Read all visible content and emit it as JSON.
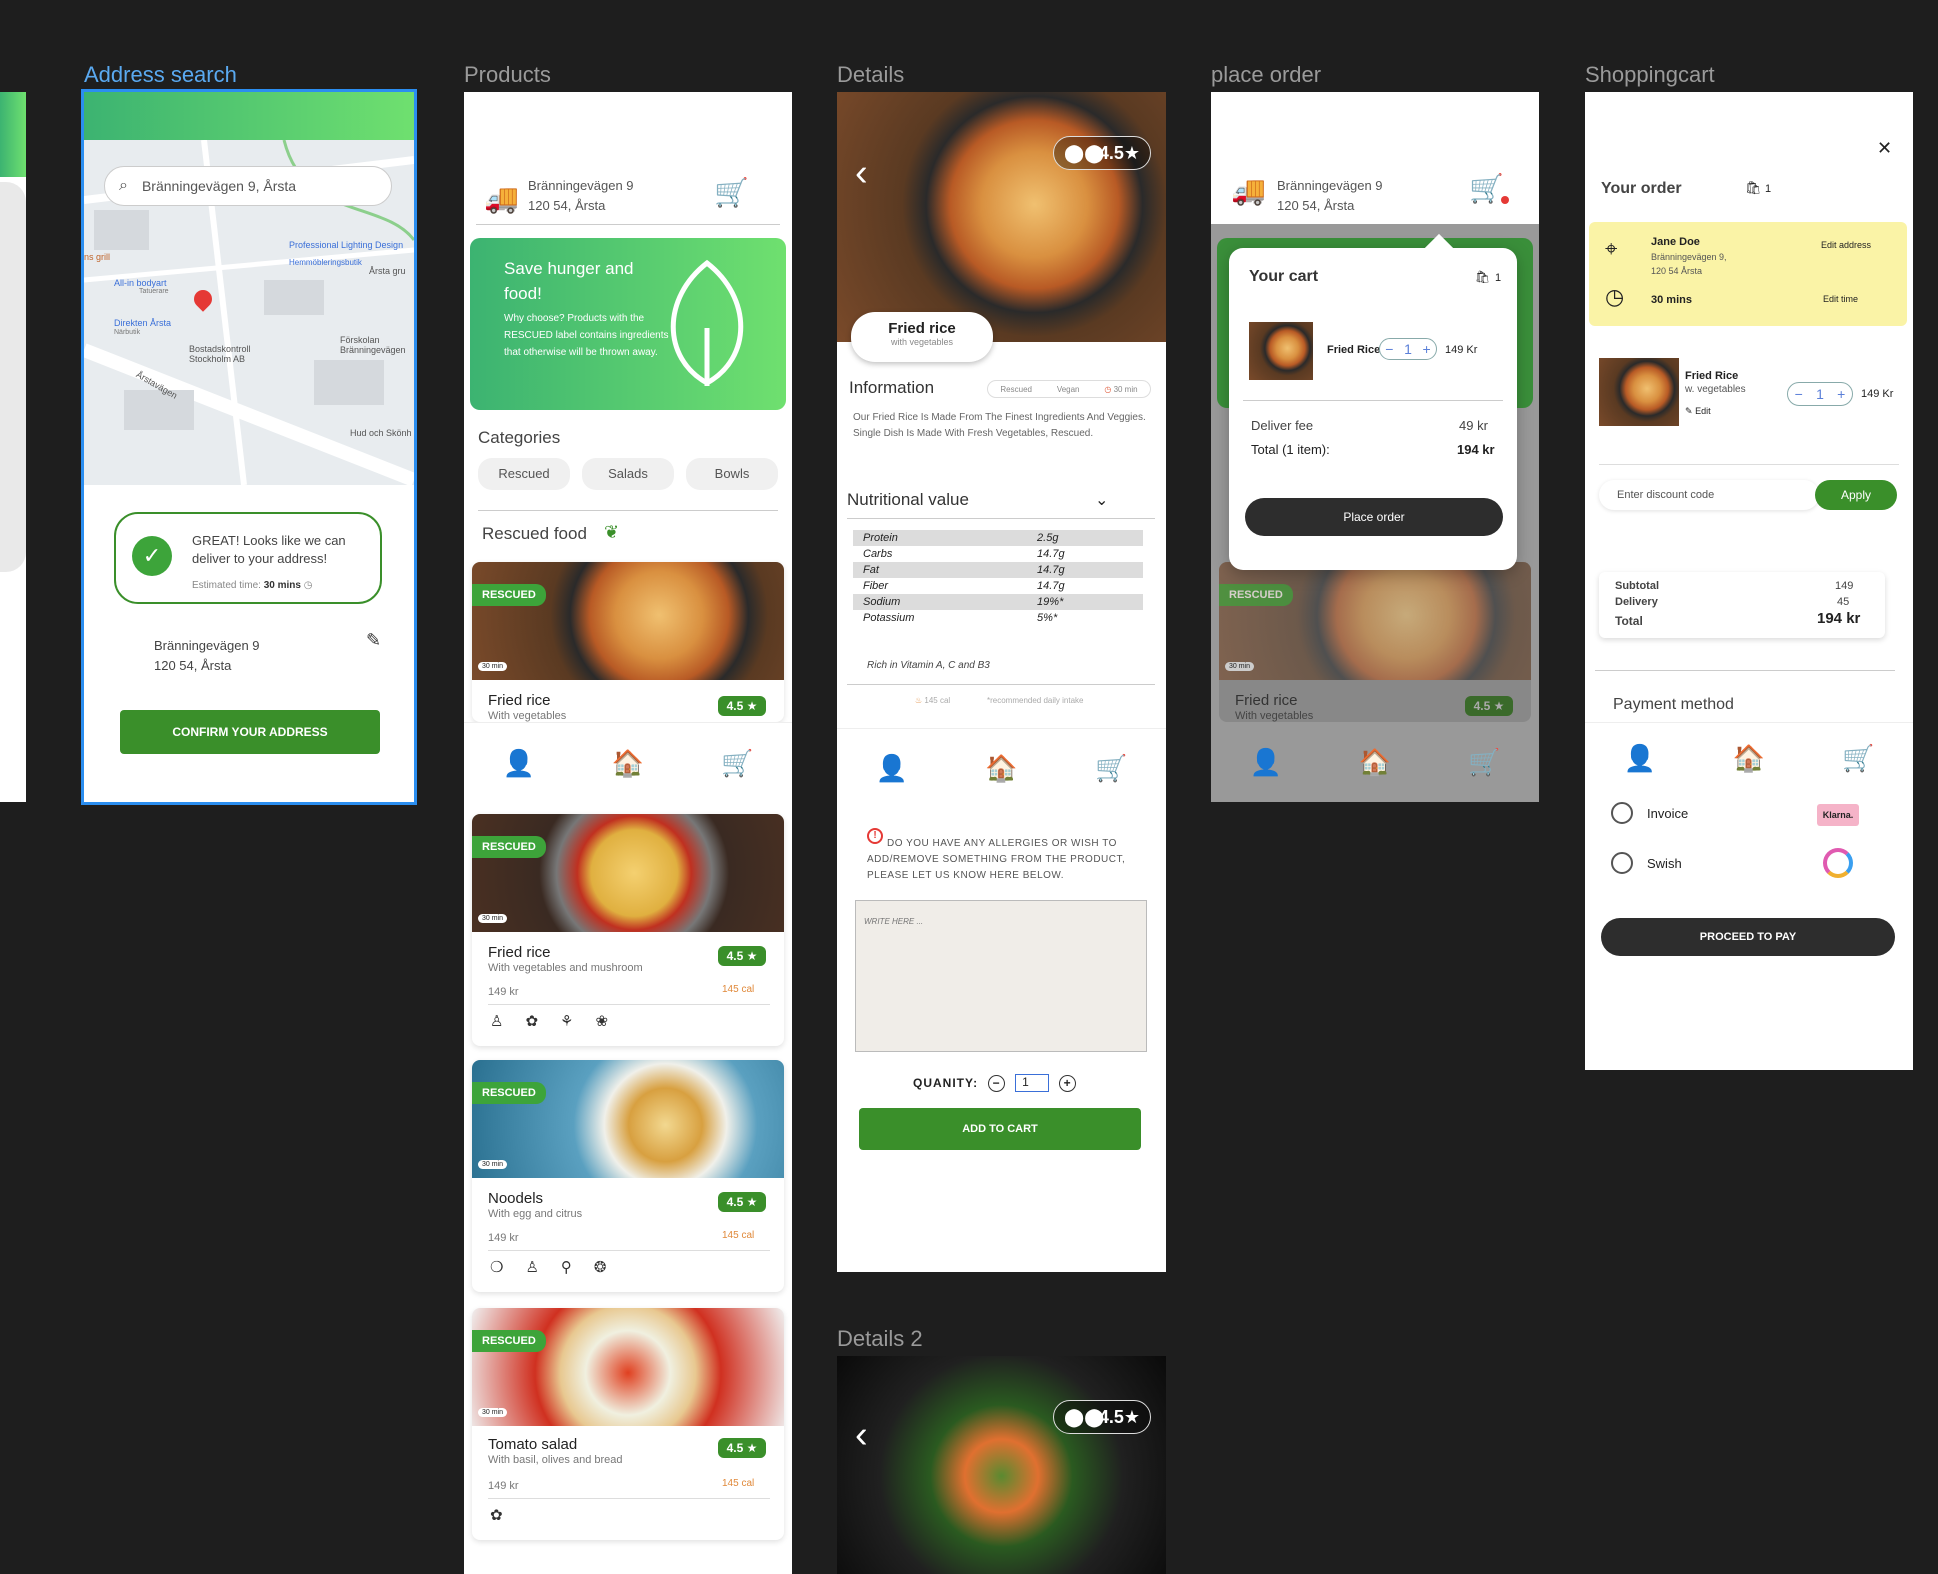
{
  "frames": {
    "address_search": "Address search",
    "products": "Products",
    "details": "Details",
    "place_order": "place order",
    "shoppingcart": "Shoppingcart",
    "details2": "Details 2"
  },
  "address": {
    "search_value": "Bränningevägen 9, Årsta",
    "map_labels": [
      "Professional Lighting Design",
      "Hemmöbleringsbutik",
      "Årsta gru",
      "ns grill",
      "All-in bodyart",
      "Tatuerare",
      "Direkten Årsta",
      "Närbutik",
      "Förskolan Bränningevägen",
      "Bostadskontroll Stockholm AB",
      "Årstavägen",
      "Hud och Skönh"
    ],
    "great_msg": "GREAT! Looks like we can deliver to your address!",
    "estimated_label": "Estimated time:",
    "estimated_value": "30 mins",
    "street": "Bränningevägen 9",
    "postal": "120 54, Årsta",
    "confirm_btn": "CONFIRM YOUR ADDRESS"
  },
  "products": {
    "street": "Bränningevägen 9",
    "postal": "120 54, Årsta",
    "banner_title": "Save hunger and food!",
    "banner_body": "Why choose? Products with the RESCUED label contains ingredients that otherwise will be thrown away.",
    "categories_title": "Categories",
    "categories": [
      "Rescued",
      "Salads",
      "Bowls"
    ],
    "rescued_title": "Rescued food",
    "rescued_tag": "RESCUED",
    "time_tag": "30 min",
    "items": [
      {
        "name": "Fried rice",
        "sub": "With vegetables",
        "rating": "4.5 ★",
        "price": "",
        "cal": ""
      },
      {
        "name": "Fried rice",
        "sub": "With vegetables and mushroom",
        "rating": "4.5 ★",
        "price": "149 kr",
        "cal": "145 cal"
      },
      {
        "name": "Noodels",
        "sub": "With egg and citrus",
        "rating": "4.5 ★",
        "price": "149 kr",
        "cal": "145 cal"
      },
      {
        "name": "Tomato salad",
        "sub": "With basil, olives and bread",
        "rating": "4.5 ★",
        "price": "149 kr",
        "cal": "145 cal"
      }
    ]
  },
  "details": {
    "rating": "4.5★",
    "name": "Fried rice",
    "sub": "with vegetables",
    "info_title": "Information",
    "tags": [
      "Rescued",
      "Vegan",
      "30 min"
    ],
    "description": "Our Fried Rice Is Made From The Finest Ingredients And Veggies. Single Dish Is Made With Fresh Vegetables, Rescued.",
    "nutrition_title": "Nutritional value",
    "nutrition": [
      {
        "k": "Protein",
        "v": "2.5g"
      },
      {
        "k": "Carbs",
        "v": "14.7g"
      },
      {
        "k": "Fat",
        "v": "14.7g"
      },
      {
        "k": "Fiber",
        "v": "14.7g"
      },
      {
        "k": "Sodium",
        "v": "19%*"
      },
      {
        "k": "Potassium",
        "v": "5%*"
      }
    ],
    "vitamins": "Rich in Vitamin A, C and B3",
    "cal": "145 cal",
    "footnote": "*recommended daily intake",
    "allergy": "DO YOU HAVE ANY ALLERGIES OR WISH TO ADD/REMOVE SOMETHING FROM THE PRODUCT, PLEASE LET US KNOW HERE BELOW.",
    "placeholder": "WRITE HERE ...",
    "qty_label": "QUANITY:",
    "qty_value": "1",
    "add_btn": "ADD TO CART"
  },
  "place_order": {
    "street": "Bränningevägen 9",
    "postal": "120 54, Årsta",
    "cart_title": "Your cart",
    "cart_count": "1",
    "item_name": "Fried Rice",
    "item_qty": "1",
    "item_price": "149 Kr",
    "fee_label": "Deliver fee",
    "fee_value": "49 kr",
    "total_label": "Total (1 item):",
    "total_value": "194 kr",
    "place_btn": "Place order",
    "rescued_tag": "RESCUED",
    "time_tag": "30 min",
    "bg_item_name": "Fried rice",
    "bg_item_sub": "With vegetables",
    "bg_rating": "4.5 ★"
  },
  "cart": {
    "title": "Your order",
    "count": "1",
    "name": "Jane Doe",
    "addr1": "Bränningevägen 9,",
    "addr2": "120 54 Årsta",
    "edit_address": "Edit address",
    "time": "30 mins",
    "edit_time": "Edit time",
    "item_name": "Fried Rice",
    "item_sub": "w. vegetables",
    "item_edit": "Edit",
    "item_qty": "1",
    "item_price": "149 Kr",
    "discount_placeholder": "Enter discount code",
    "apply": "Apply",
    "subtotal_label": "Subtotal",
    "delivery_label": "Delivery",
    "total_label": "Total",
    "subtotal_value": "149",
    "delivery_value": "45",
    "total_value": "194 kr",
    "payment_title": "Payment method",
    "pay_options": [
      "Invoice",
      "Swish"
    ],
    "klarna": "Klarna.",
    "proceed_btn": "PROCEED TO PAY"
  },
  "details2": {
    "rating": "4.5★"
  },
  "colors": {
    "green": "#3a8f2a",
    "accent_green": "#6fe06f",
    "dark": "#2d2d2d",
    "yellow": "#faf3a6"
  }
}
